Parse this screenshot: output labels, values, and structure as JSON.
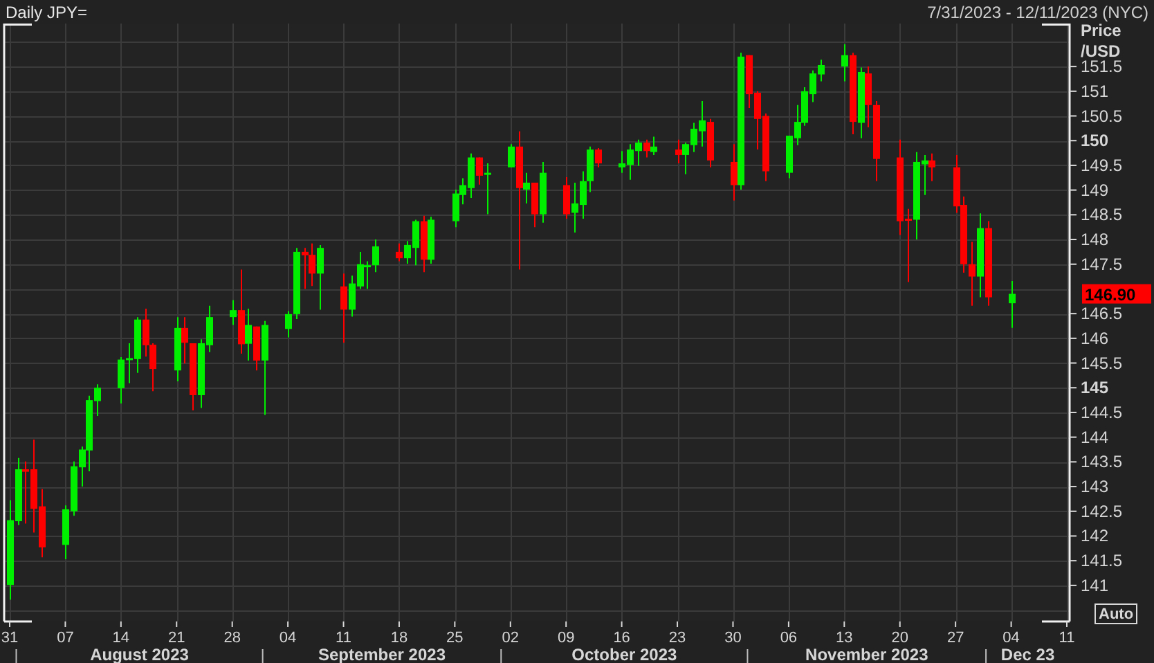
{
  "header": {
    "title": "Daily JPY=",
    "date_range": "7/31/2023 - 12/11/2023 (NYC)"
  },
  "chart": {
    "last_price": "146.90",
    "auto_button": "Auto",
    "months": [
      "August 2023",
      "September 2023",
      "October 2023",
      "November 2023",
      "Dec 23"
    ],
    "chart_data": {
      "type": "candlestick",
      "ylabel": "Price /USD",
      "ylim": [
        140.27,
        152.37
      ],
      "xlim": [
        "2023-07-31",
        "2023-12-11"
      ],
      "grid": true,
      "xticks": [
        {
          "value": "2023-07-31",
          "label": "31"
        },
        {
          "value": "2023-08-07",
          "label": "07"
        },
        {
          "value": "2023-08-14",
          "label": "14"
        },
        {
          "value": "2023-08-21",
          "label": "21"
        },
        {
          "value": "2023-08-28",
          "label": "28"
        },
        {
          "value": "2023-09-04",
          "label": "04"
        },
        {
          "value": "2023-09-11",
          "label": "11"
        },
        {
          "value": "2023-09-18",
          "label": "18"
        },
        {
          "value": "2023-09-25",
          "label": "25"
        },
        {
          "value": "2023-10-02",
          "label": "02"
        },
        {
          "value": "2023-10-09",
          "label": "09"
        },
        {
          "value": "2023-10-16",
          "label": "16"
        },
        {
          "value": "2023-10-23",
          "label": "23"
        },
        {
          "value": "2023-10-30",
          "label": "30"
        },
        {
          "value": "2023-11-06",
          "label": "06"
        },
        {
          "value": "2023-11-13",
          "label": "13"
        },
        {
          "value": "2023-11-20",
          "label": "20"
        },
        {
          "value": "2023-11-27",
          "label": "27"
        },
        {
          "value": "2023-12-04",
          "label": "04"
        },
        {
          "value": "2023-12-11",
          "label": "11"
        }
      ],
      "x": [
        "2023-07-31",
        "2023-08-01",
        "2023-08-02",
        "2023-08-03",
        "2023-08-04",
        "2023-08-07",
        "2023-08-08",
        "2023-08-09",
        "2023-08-10",
        "2023-08-11",
        "2023-08-14",
        "2023-08-15",
        "2023-08-16",
        "2023-08-17",
        "2023-08-18",
        "2023-08-21",
        "2023-08-22",
        "2023-08-23",
        "2023-08-24",
        "2023-08-25",
        "2023-08-28",
        "2023-08-29",
        "2023-08-30",
        "2023-08-31",
        "2023-09-01",
        "2023-09-04",
        "2023-09-05",
        "2023-09-06",
        "2023-09-07",
        "2023-09-08",
        "2023-09-11",
        "2023-09-12",
        "2023-09-13",
        "2023-09-14",
        "2023-09-15",
        "2023-09-18",
        "2023-09-19",
        "2023-09-20",
        "2023-09-21",
        "2023-09-22",
        "2023-09-25",
        "2023-09-26",
        "2023-09-27",
        "2023-09-28",
        "2023-09-29",
        "2023-10-02",
        "2023-10-03",
        "2023-10-04",
        "2023-10-05",
        "2023-10-06",
        "2023-10-09",
        "2023-10-10",
        "2023-10-11",
        "2023-10-12",
        "2023-10-13",
        "2023-10-16",
        "2023-10-17",
        "2023-10-18",
        "2023-10-19",
        "2023-10-20",
        "2023-10-23",
        "2023-10-24",
        "2023-10-25",
        "2023-10-26",
        "2023-10-27",
        "2023-10-30",
        "2023-10-31",
        "2023-11-01",
        "2023-11-02",
        "2023-11-03",
        "2023-11-06",
        "2023-11-07",
        "2023-11-08",
        "2023-11-09",
        "2023-11-10",
        "2023-11-13",
        "2023-11-14",
        "2023-11-15",
        "2023-11-16",
        "2023-11-17",
        "2023-11-20",
        "2023-11-21",
        "2023-11-22",
        "2023-11-23",
        "2023-11-24",
        "2023-11-27",
        "2023-11-28",
        "2023-11-29",
        "2023-11-30",
        "2023-12-01",
        "2023-12-04"
      ],
      "ohlc": [
        [
          141.01,
          142.72,
          140.71,
          142.32
        ],
        [
          142.3,
          143.58,
          142.22,
          143.35
        ],
        [
          143.35,
          143.51,
          142.25,
          143.3
        ],
        [
          143.35,
          143.95,
          142.07,
          142.55
        ],
        [
          142.6,
          142.95,
          141.57,
          141.77
        ],
        [
          141.82,
          142.62,
          141.53,
          142.54
        ],
        [
          142.5,
          143.51,
          142.41,
          143.41
        ],
        [
          143.39,
          143.81,
          143.0,
          143.75
        ],
        [
          143.73,
          144.84,
          143.31,
          144.75
        ],
        [
          144.73,
          145.07,
          144.43,
          145.0
        ],
        [
          144.99,
          145.62,
          144.68,
          145.57
        ],
        [
          145.58,
          145.9,
          145.09,
          145.6
        ],
        [
          145.58,
          146.43,
          145.3,
          146.38
        ],
        [
          146.38,
          146.6,
          145.63,
          145.86
        ],
        [
          145.87,
          145.9,
          144.93,
          145.38
        ],
        [
          145.35,
          146.43,
          145.13,
          146.21
        ],
        [
          146.21,
          146.43,
          145.49,
          145.91
        ],
        [
          145.9,
          145.9,
          144.54,
          144.85
        ],
        [
          144.85,
          145.98,
          144.59,
          145.9
        ],
        [
          145.86,
          146.66,
          145.72,
          146.43
        ],
        [
          146.43,
          146.77,
          146.27,
          146.57
        ],
        [
          146.57,
          147.39,
          145.69,
          145.88
        ],
        [
          145.89,
          146.6,
          145.55,
          146.27
        ],
        [
          146.24,
          146.24,
          145.35,
          145.55
        ],
        [
          145.55,
          146.35,
          144.45,
          146.27
        ],
        [
          146.19,
          146.55,
          146.02,
          146.49
        ],
        [
          146.49,
          147.83,
          146.39,
          147.75
        ],
        [
          147.75,
          147.83,
          147.0,
          147.68
        ],
        [
          147.69,
          147.92,
          147.06,
          147.31
        ],
        [
          147.31,
          147.89,
          146.58,
          147.83
        ],
        [
          147.05,
          147.31,
          145.91,
          146.58
        ],
        [
          146.58,
          147.27,
          146.44,
          147.11
        ],
        [
          147.05,
          147.75,
          147.0,
          147.5
        ],
        [
          147.46,
          147.56,
          147.0,
          147.48
        ],
        [
          147.48,
          148.0,
          147.34,
          147.86
        ],
        [
          147.75,
          147.92,
          147.56,
          147.62
        ],
        [
          147.62,
          147.97,
          147.51,
          147.89
        ],
        [
          147.83,
          148.4,
          147.48,
          148.37
        ],
        [
          148.37,
          148.48,
          147.34,
          147.59
        ],
        [
          147.59,
          148.46,
          147.51,
          148.4
        ],
        [
          148.37,
          149.01,
          148.25,
          148.93
        ],
        [
          148.9,
          149.24,
          148.71,
          149.1
        ],
        [
          149.04,
          149.74,
          148.84,
          149.66
        ],
        [
          149.66,
          149.66,
          149.11,
          149.29
        ],
        [
          149.33,
          149.54,
          148.51,
          149.35
        ],
        [
          149.46,
          149.93,
          149.46,
          149.88
        ],
        [
          149.88,
          150.19,
          147.39,
          149.04
        ],
        [
          149.01,
          149.35,
          148.73,
          149.15
        ],
        [
          149.15,
          149.15,
          148.25,
          148.51
        ],
        [
          148.51,
          149.57,
          148.34,
          149.35
        ],
        [
          149.1,
          149.26,
          148.42,
          148.51
        ],
        [
          148.54,
          149.15,
          148.14,
          148.73
        ],
        [
          148.7,
          149.38,
          148.42,
          149.18
        ],
        [
          149.18,
          149.88,
          148.96,
          149.82
        ],
        [
          149.82,
          149.85,
          149.46,
          149.54
        ],
        [
          149.46,
          149.79,
          149.35,
          149.54
        ],
        [
          149.51,
          149.93,
          149.21,
          149.82
        ],
        [
          149.79,
          150.02,
          149.49,
          149.96
        ],
        [
          149.96,
          150.02,
          149.66,
          149.79
        ],
        [
          149.77,
          150.08,
          149.71,
          149.88
        ],
        [
          149.82,
          150.02,
          149.54,
          149.71
        ],
        [
          149.71,
          149.96,
          149.32,
          149.93
        ],
        [
          149.91,
          150.36,
          149.77,
          150.24
        ],
        [
          150.19,
          150.8,
          149.88,
          150.41
        ],
        [
          150.38,
          150.44,
          149.46,
          149.6
        ],
        [
          149.57,
          149.93,
          148.79,
          149.1
        ],
        [
          149.1,
          151.78,
          149.01,
          151.7
        ],
        [
          151.73,
          151.73,
          150.66,
          150.94
        ],
        [
          150.97,
          151.0,
          149.82,
          150.44
        ],
        [
          150.5,
          150.55,
          149.18,
          149.38
        ],
        [
          149.35,
          150.1,
          149.24,
          150.1
        ],
        [
          150.05,
          150.72,
          149.91,
          150.38
        ],
        [
          150.36,
          151.08,
          150.3,
          151.0
        ],
        [
          150.94,
          151.42,
          150.78,
          151.36
        ],
        [
          151.34,
          151.64,
          151.2,
          151.53
        ],
        [
          151.5,
          151.95,
          151.2,
          151.73
        ],
        [
          151.73,
          151.78,
          150.13,
          150.38
        ],
        [
          150.36,
          151.48,
          150.05,
          151.39
        ],
        [
          151.36,
          151.5,
          150.27,
          150.72
        ],
        [
          150.72,
          150.8,
          149.18,
          149.63
        ],
        [
          149.66,
          150.02,
          148.09,
          148.37
        ],
        [
          148.42,
          148.62,
          147.14,
          148.41
        ],
        [
          148.4,
          149.77,
          148.0,
          149.57
        ],
        [
          149.52,
          149.71,
          148.9,
          149.6
        ],
        [
          149.6,
          149.74,
          149.18,
          149.46
        ],
        [
          149.46,
          149.71,
          148.54,
          148.67
        ],
        [
          148.7,
          148.87,
          147.33,
          147.5
        ],
        [
          147.5,
          147.95,
          146.66,
          147.25
        ],
        [
          147.25,
          148.53,
          146.83,
          148.23
        ],
        [
          148.23,
          148.37,
          146.66,
          146.83
        ],
        [
          146.71,
          147.16,
          146.21,
          146.9
        ]
      ],
      "yticks": [
        {
          "value": 151.5,
          "label": "151.5"
        },
        {
          "value": 151,
          "label": "151"
        },
        {
          "value": 150.5,
          "label": "150.5"
        },
        {
          "value": 150,
          "label": "150"
        },
        {
          "value": 149.5,
          "label": "149.5"
        },
        {
          "value": 149,
          "label": "149"
        },
        {
          "value": 148.5,
          "label": "148.5"
        },
        {
          "value": 148,
          "label": "148"
        },
        {
          "value": 147.5,
          "label": "147.5"
        },
        {
          "value": 146.5,
          "label": "146.5"
        },
        {
          "value": 146,
          "label": "146"
        },
        {
          "value": 145.5,
          "label": "145.5"
        },
        {
          "value": 145,
          "label": "145"
        },
        {
          "value": 144.5,
          "label": "144.5"
        },
        {
          "value": 144,
          "label": "144"
        },
        {
          "value": 143.5,
          "label": "143.5"
        },
        {
          "value": 143,
          "label": "143"
        },
        {
          "value": 142.5,
          "label": "142.5"
        },
        {
          "value": 142,
          "label": "142"
        },
        {
          "value": 141.5,
          "label": "141.5"
        },
        {
          "value": 141,
          "label": "141"
        }
      ]
    }
  }
}
